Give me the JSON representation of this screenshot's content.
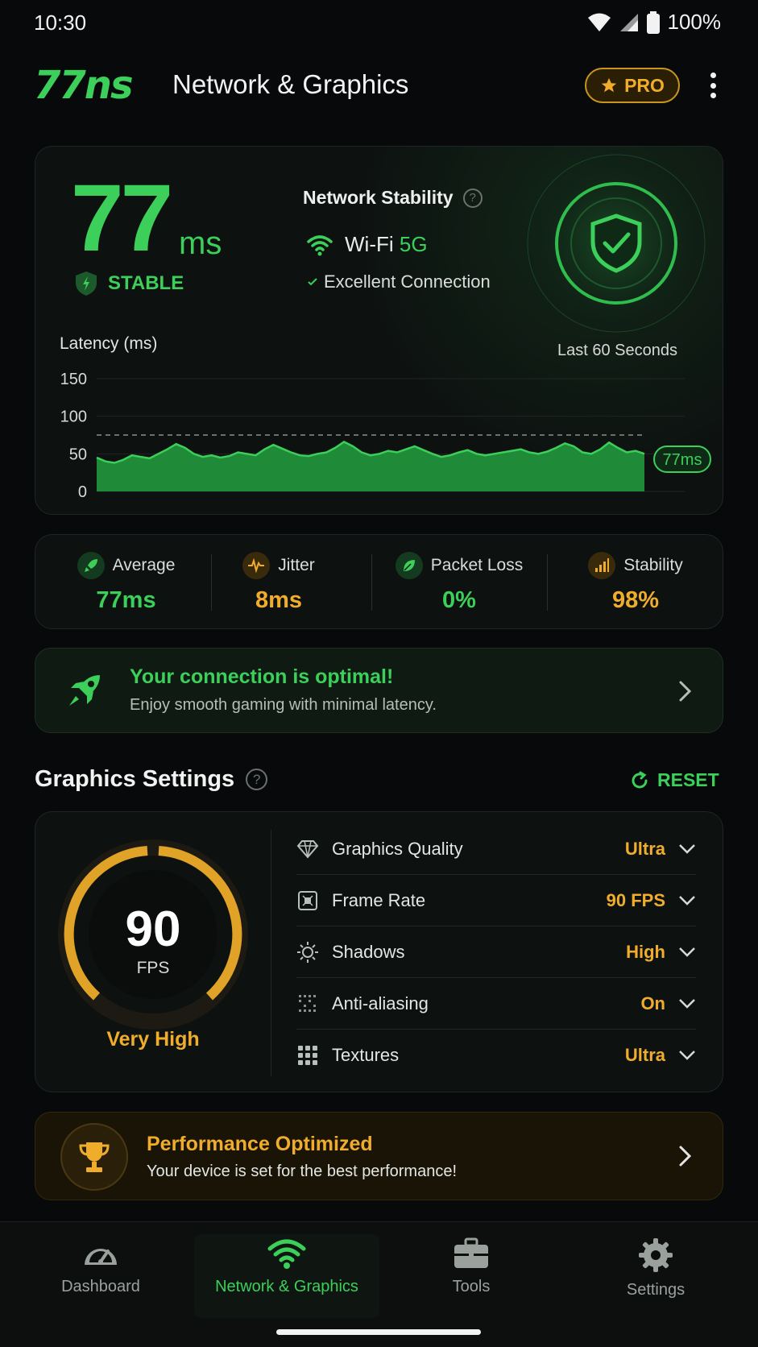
{
  "status_bar": {
    "time": "10:30",
    "battery": "100%"
  },
  "header": {
    "logo": "77ns",
    "title": "Network & Graphics",
    "pro_label": "PRO"
  },
  "network": {
    "latency_value": "77",
    "latency_unit": "ms",
    "status": "STABLE",
    "stability_title": "Network Stability",
    "wifi_label": "Wi-Fi",
    "wifi_band": "5G",
    "connection_quality": "Excellent Connection"
  },
  "latency_chart": {
    "label": "Latency (ms)",
    "window": "Last 60 Seconds",
    "current_badge": "77ms"
  },
  "chart_data": {
    "type": "area",
    "title": "",
    "xlabel": "",
    "ylabel": "Latency (ms)",
    "ylim": [
      0,
      150
    ],
    "yticks": [
      "150",
      "100",
      "50",
      "0"
    ],
    "reference_line": 75,
    "series": [
      {
        "values": [
          45,
          40,
          38,
          42,
          48,
          46,
          44,
          50,
          56,
          63,
          58,
          50,
          46,
          48,
          45,
          47,
          52,
          50,
          48,
          56,
          62,
          57,
          52,
          48,
          47,
          50,
          52,
          58,
          66,
          60,
          52,
          48,
          50,
          54,
          52,
          56,
          60,
          55,
          50,
          46,
          48,
          52,
          55,
          50,
          48,
          50,
          52,
          54,
          56,
          52,
          50,
          53,
          58,
          64,
          60,
          52,
          50,
          56,
          65,
          58,
          52,
          54,
          50
        ]
      }
    ]
  },
  "stats": [
    {
      "label": "Average",
      "value": "77ms",
      "color": "#3ccf5a"
    },
    {
      "label": "Jitter",
      "value": "8ms",
      "color": "#f0ad2c"
    },
    {
      "label": "Packet Loss",
      "value": "0%",
      "color": "#3ccf5a"
    },
    {
      "label": "Stability",
      "value": "98%",
      "color": "#f0ad2c"
    }
  ],
  "optimal_banner": {
    "title": "Your connection is optimal!",
    "subtitle": "Enjoy smooth gaming with minimal latency."
  },
  "graphics": {
    "title": "Graphics Settings",
    "reset_label": "RESET",
    "fps_value": "90",
    "fps_unit": "FPS",
    "fps_quality": "Very High",
    "settings": [
      {
        "label": "Graphics Quality",
        "value": "Ultra",
        "icon": "diamond-icon"
      },
      {
        "label": "Frame Rate",
        "value": "90 FPS",
        "icon": "frame-icon"
      },
      {
        "label": "Shadows",
        "value": "High",
        "icon": "sun-icon"
      },
      {
        "label": "Anti-aliasing",
        "value": "On",
        "icon": "dots-icon"
      },
      {
        "label": "Textures",
        "value": "Ultra",
        "icon": "grid-icon"
      }
    ]
  },
  "performance_banner": {
    "title": "Performance Optimized",
    "subtitle": "Your device is set for the best performance!"
  },
  "nav": [
    {
      "label": "Dashboard",
      "icon": "speedometer-icon"
    },
    {
      "label": "Network & Graphics",
      "icon": "wifi-icon"
    },
    {
      "label": "Tools",
      "icon": "briefcase-icon"
    },
    {
      "label": "Settings",
      "icon": "gear-icon"
    }
  ],
  "colors": {
    "accent_green": "#3ccf5a",
    "accent_amber": "#f0ad2c",
    "background": "#07090a"
  }
}
